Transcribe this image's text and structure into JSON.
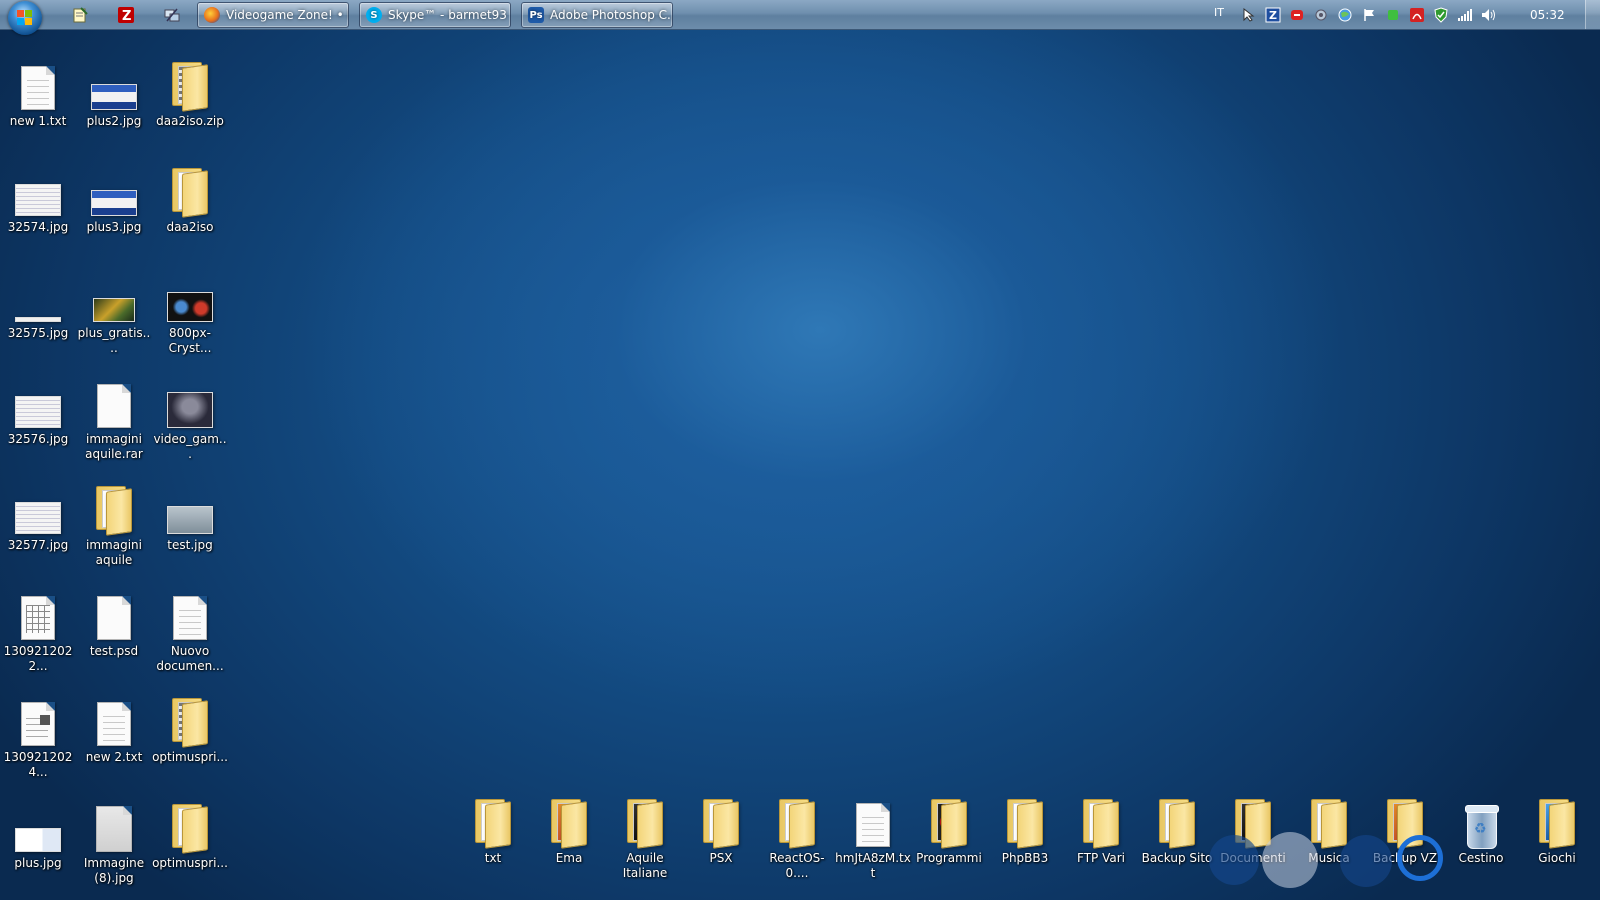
{
  "taskbar": {
    "tasks": [
      {
        "label": "Videogame Zone! • L...",
        "icon": "firefox-icon",
        "color": "#e76f1c"
      },
      {
        "label": "Skype™ - barmet93",
        "icon": "skype-icon",
        "color": "#00aff0"
      },
      {
        "label": "Adobe Photoshop C...",
        "icon": "photoshop-icon",
        "color": "#1e5aa8",
        "icon_text": "Ps"
      }
    ],
    "language": "IT",
    "clock": "05:32"
  },
  "desktop": {
    "left_icons": [
      {
        "label": "new 1.txt",
        "type": "doc-lines"
      },
      {
        "label": "plus2.jpg",
        "type": "thumb-blue"
      },
      {
        "label": "daa2iso.zip",
        "type": "folder-zip"
      },
      {
        "label": "32574.jpg",
        "type": "thumb-sheet"
      },
      {
        "label": "plus3.jpg",
        "type": "thumb-blue"
      },
      {
        "label": "daa2iso",
        "type": "folder"
      },
      {
        "label": "32575.jpg",
        "type": "thumb-thin"
      },
      {
        "label": "plus_gratis....",
        "type": "thumb-game"
      },
      {
        "label": "800px-Cryst...",
        "type": "thumb-dark"
      },
      {
        "label": "32576.jpg",
        "type": "thumb-sheet"
      },
      {
        "label": "immagini\naquile.rar",
        "type": "doc"
      },
      {
        "label": "video_gam...",
        "type": "thumb-figure"
      },
      {
        "label": "32577.jpg",
        "type": "thumb-sheet"
      },
      {
        "label": "immagini\naquile",
        "type": "folder"
      },
      {
        "label": "test.jpg",
        "type": "thumb-grey"
      },
      {
        "label": "1309212022...",
        "type": "doc-table"
      },
      {
        "label": "test.psd",
        "type": "doc"
      },
      {
        "label": "Nuovo\ndocumen...",
        "type": "doc-lines"
      },
      {
        "label": "1309212024...",
        "type": "doc-form"
      },
      {
        "label": "new 2.txt",
        "type": "doc-lines"
      },
      {
        "label": "optimuspri...",
        "type": "folder-zip"
      },
      {
        "label": "plus.jpg",
        "type": "thumb-page"
      },
      {
        "label": "Immagine\n(8).jpg",
        "type": "doc-scan"
      },
      {
        "label": "optimuspri...",
        "type": "folder"
      }
    ],
    "bottom_icons": [
      {
        "label": "txt",
        "type": "folder"
      },
      {
        "label": "Ema",
        "type": "folder-photo"
      },
      {
        "label": "Aquile\nItaliane",
        "type": "folder-dark"
      },
      {
        "label": "PSX",
        "type": "folder"
      },
      {
        "label": "ReactOS-0....",
        "type": "folder"
      },
      {
        "label": "hmJtA8zM.txt",
        "type": "doc-lines"
      },
      {
        "label": "Programmi",
        "type": "folder-red"
      },
      {
        "label": "PhpBB3",
        "type": "folder"
      },
      {
        "label": "FTP Vari",
        "type": "folder"
      },
      {
        "label": "Backup Sito",
        "type": "folder"
      },
      {
        "label": "Documenti",
        "type": "folder-dark"
      },
      {
        "label": "Musica",
        "type": "folder"
      },
      {
        "label": "Backup VZ",
        "type": "folder-photo"
      },
      {
        "label": "Cestino",
        "type": "recycle-bin"
      },
      {
        "label": "Giochi",
        "type": "folder-blue"
      }
    ]
  }
}
